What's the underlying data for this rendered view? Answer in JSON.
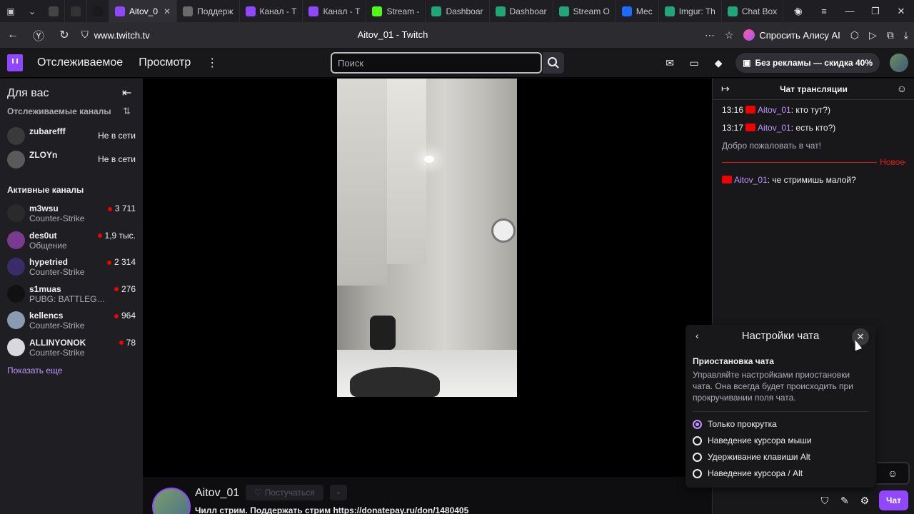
{
  "browser": {
    "tabs": [
      {
        "label": "",
        "color": "#444",
        "active": false
      },
      {
        "label": "",
        "color": "#333",
        "active": false
      },
      {
        "label": "",
        "color": "#1a1a1a",
        "active": false
      },
      {
        "label": "Aitov_0",
        "color": "#9147ff",
        "active": true
      },
      {
        "label": "Поддерж",
        "color": "#6a6a6a",
        "active": false
      },
      {
        "label": "Канал - Т",
        "color": "#9147ff",
        "active": false
      },
      {
        "label": "Канал - Т",
        "color": "#9147ff",
        "active": false
      },
      {
        "label": "Stream - ",
        "color": "#53fc18",
        "active": false
      },
      {
        "label": "Dashboar",
        "color": "#21a67a",
        "active": false
      },
      {
        "label": "Dashboar",
        "color": "#21a67a",
        "active": false
      },
      {
        "label": "Stream O",
        "color": "#21a67a",
        "active": false
      },
      {
        "label": "Мес",
        "color": "#1e6bff",
        "active": false
      },
      {
        "label": "Imgur: Th",
        "color": "#21a67a",
        "active": false
      },
      {
        "label": "Chat Box",
        "color": "#21a67a",
        "active": false
      }
    ],
    "url": "www.twitch.tv",
    "page_title": "Aitov_01 - Twitch",
    "alice_label": "Спросить Алису AI"
  },
  "header": {
    "nav_following": "Отслеживаемое",
    "nav_browse": "Просмотр",
    "search_placeholder": "Поиск",
    "promo": "Без рекламы — скидка 40%"
  },
  "sidebar": {
    "title": "Для вас",
    "followed_title": "Отслеживаемые каналы",
    "followed": [
      {
        "name": "zubarefff",
        "status": "Не в сети",
        "avatar": "#3a3a3a"
      },
      {
        "name": "ZLOYn",
        "status": "Не в сети",
        "avatar": "#5a5a5a"
      }
    ],
    "active_title": "Активные каналы",
    "active": [
      {
        "name": "m3wsu",
        "game": "Counter-Strike",
        "viewers": "3 711",
        "avatar": "#2a2a2a"
      },
      {
        "name": "des0ut",
        "game": "Общение",
        "viewers": "1,9 тыс.",
        "avatar": "#7a3b8f"
      },
      {
        "name": "hypetried",
        "game": "Counter-Strike",
        "viewers": "2 314",
        "avatar": "#3b2b6b"
      },
      {
        "name": "s1muas",
        "game": "PUBG: BATTLEGR...",
        "viewers": "276",
        "avatar": "#111111"
      },
      {
        "name": "kellencs",
        "game": "Counter-Strike",
        "viewers": "964",
        "avatar": "#8a9ab0"
      },
      {
        "name": "ALLINYONOK",
        "game": "Counter-Strike",
        "viewers": "78",
        "avatar": "#d8d8de"
      }
    ],
    "show_more": "Показать еще"
  },
  "stream": {
    "channel": "Aitov_01",
    "follow_label": "Постучаться",
    "title": "Чилл стрим. Поддержать стрим https://donatepay.ru/don/1480405"
  },
  "chat": {
    "title": "Чат трансляции",
    "messages": [
      {
        "time": "13:16",
        "user": "Aitov_01",
        "text": ": кто тут?)"
      },
      {
        "time": "13:17",
        "user": "Aitov_01",
        "text": ": есть кто?)"
      }
    ],
    "welcome": "Добро пожаловать в чат!",
    "new_label": "Новое",
    "new_message": {
      "user": "Aitov_01",
      "text": ": че стримишь малой?"
    },
    "send_label": "Чат"
  },
  "settings_popup": {
    "title": "Настройки чата",
    "subtitle": "Приостановка чата",
    "description": "Управляйте настройками приостановки чата. Она всегда будет происходить при прокручивании поля чата.",
    "options": [
      {
        "label": "Только прокрутка",
        "selected": true
      },
      {
        "label": "Наведение курсора мыши",
        "selected": false
      },
      {
        "label": "Удерживание клавиши Alt",
        "selected": false
      },
      {
        "label": "Наведение курсора / Alt",
        "selected": false
      }
    ]
  },
  "colors": {
    "brand": "#9147ff",
    "accent_text": "#bf94ff",
    "live": "#eb0400"
  }
}
